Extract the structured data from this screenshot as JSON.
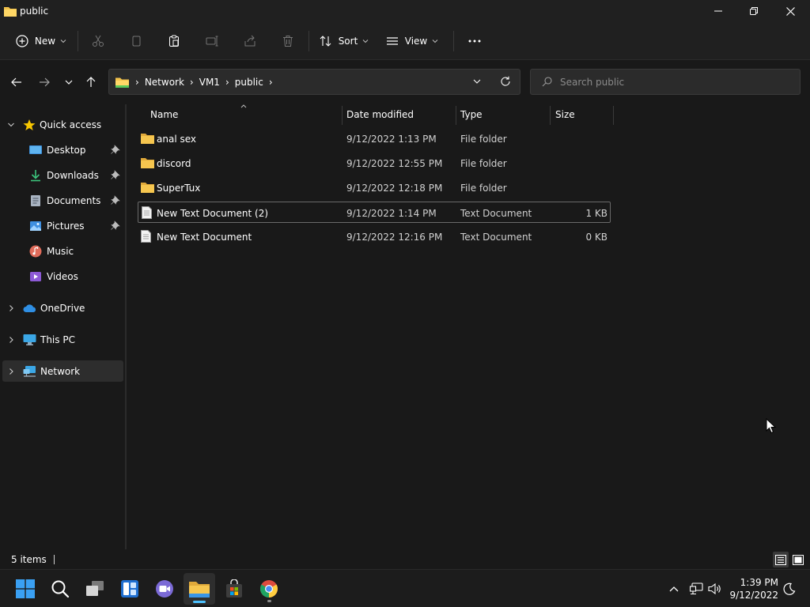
{
  "window": {
    "title": "public"
  },
  "toolbar": {
    "new_label": "New",
    "sort_label": "Sort",
    "view_label": "View"
  },
  "address": {
    "breadcrumbs": [
      "Network",
      "VM1",
      "public"
    ]
  },
  "search": {
    "placeholder": "Search public"
  },
  "sidebar": {
    "quick_access": "Quick access",
    "items": [
      {
        "label": "Desktop",
        "icon": "desktop-icon",
        "pinned": true
      },
      {
        "label": "Downloads",
        "icon": "downloads-icon",
        "pinned": true
      },
      {
        "label": "Documents",
        "icon": "documents-icon",
        "pinned": true
      },
      {
        "label": "Pictures",
        "icon": "pictures-icon",
        "pinned": true
      },
      {
        "label": "Music",
        "icon": "music-icon",
        "pinned": false
      },
      {
        "label": "Videos",
        "icon": "videos-icon",
        "pinned": false
      }
    ],
    "onedrive": "OneDrive",
    "this_pc": "This PC",
    "network": "Network"
  },
  "filelist": {
    "columns": {
      "name": "Name",
      "date": "Date modified",
      "type": "Type",
      "size": "Size"
    },
    "rows": [
      {
        "name": "anal sex",
        "date": "9/12/2022 1:13 PM",
        "type": "File folder",
        "size": "",
        "icon": "folder-icon"
      },
      {
        "name": "discord",
        "date": "9/12/2022 12:55 PM",
        "type": "File folder",
        "size": "",
        "icon": "folder-icon"
      },
      {
        "name": "SuperTux",
        "date": "9/12/2022 12:18 PM",
        "type": "File folder",
        "size": "",
        "icon": "folder-icon"
      },
      {
        "name": "New Text Document (2)",
        "date": "9/12/2022 1:14 PM",
        "type": "Text Document",
        "size": "1 KB",
        "icon": "text-file-icon"
      },
      {
        "name": "New Text Document",
        "date": "9/12/2022 12:16 PM",
        "type": "Text Document",
        "size": "0 KB",
        "icon": "text-file-icon"
      }
    ]
  },
  "status": {
    "item_count": "5 items"
  },
  "taskbar": {
    "time": "1:39 PM",
    "date": "9/12/2022"
  },
  "colors": {
    "accent": "#4cc2ff",
    "folder": "#f2c24b",
    "background": "#191919",
    "chrome": "#202020"
  }
}
